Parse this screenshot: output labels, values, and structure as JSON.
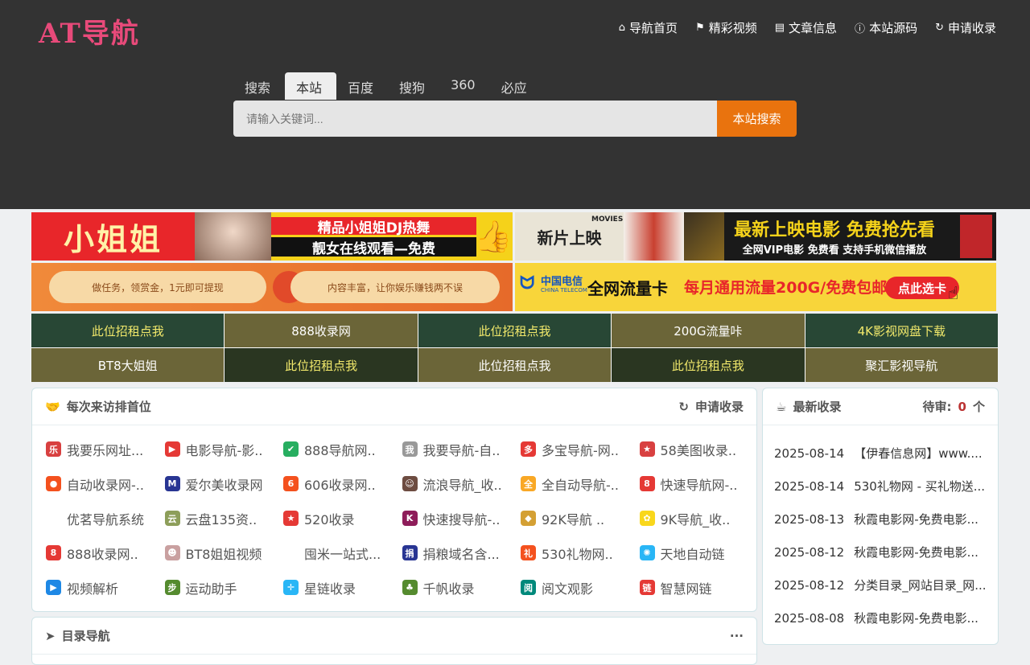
{
  "logo": "AT导航",
  "nav": [
    {
      "icon": "home-icon",
      "label": "导航首页"
    },
    {
      "icon": "flag-icon",
      "label": "精彩视频"
    },
    {
      "icon": "book-icon",
      "label": "文章信息"
    },
    {
      "icon": "info-icon",
      "label": "本站源码"
    },
    {
      "icon": "refresh-icon",
      "label": "申请收录"
    }
  ],
  "search": {
    "tabs": [
      "搜索",
      "本站",
      "百度",
      "搜狗",
      "360",
      "必应"
    ],
    "active_tab": "本站",
    "placeholder": "请输入关键词...",
    "button": "本站搜索"
  },
  "banners": [
    {
      "left_text": "小姐姐",
      "right_line1": "精品小姐姐DJ热舞",
      "right_line2": "靓女在线观看—免费"
    },
    {
      "left_text": "新片上映",
      "tag": "MOVIES",
      "line1": "最新上映电影 免费抢先看",
      "line2": "全网VIP电影 免费看 支持手机微信播放"
    },
    {
      "pill1": "做任务，领赏金，1元即可提现",
      "pill2": "内容丰富，让你娱乐赚钱两不误"
    },
    {
      "brand": "中国电信",
      "brand_en": "CHINA TELECOM",
      "line1": "全网流量卡",
      "line2": "每月通用流量200G/免费包邮",
      "cta": "点此选卡"
    }
  ],
  "ad_grid": [
    {
      "label": "此位招租点我",
      "bg": "#284735",
      "color": "#f2e96b"
    },
    {
      "label": "888收录网",
      "bg": "#6b6538",
      "color": "#ffffff"
    },
    {
      "label": "此位招租点我",
      "bg": "#284735",
      "color": "#f2e96b"
    },
    {
      "label": "200G流量咔",
      "bg": "#6b6538",
      "color": "#ffffff"
    },
    {
      "label": "4K影视网盘下载",
      "bg": "#284735",
      "color": "#f2e96b"
    },
    {
      "label": "BT8大姐姐",
      "bg": "#6b6538",
      "color": "#ffffff"
    },
    {
      "label": "此位招租点我",
      "bg": "#2a3621",
      "color": "#f2e96b"
    },
    {
      "label": "此位招租点我",
      "bg": "#6b6538",
      "color": "#ffffff"
    },
    {
      "label": "此位招租点我",
      "bg": "#2a3621",
      "color": "#f2e96b"
    },
    {
      "label": "聚汇影视导航",
      "bg": "#6b6538",
      "color": "#ffffff"
    }
  ],
  "first_visit": {
    "title": "每次来访排首位",
    "action": "申请收录",
    "links": [
      {
        "label": "我要乐网址...",
        "color": "#d84040",
        "glyph": "乐"
      },
      {
        "label": "电影导航-影..",
        "color": "#e53935",
        "glyph": "▶"
      },
      {
        "label": "888导航网..",
        "color": "#27ae60",
        "glyph": "✔"
      },
      {
        "label": "我要导航-自..",
        "color": "#999999",
        "glyph": "我"
      },
      {
        "label": "多宝导航-网..",
        "color": "#e53935",
        "glyph": "多"
      },
      {
        "label": "58美图收录..",
        "color": "#d84040",
        "glyph": "★"
      },
      {
        "label": "自动收录网-..",
        "color": "#f4511e",
        "glyph": "●"
      },
      {
        "label": "爱尔美收录网",
        "color": "#283593",
        "glyph": "M"
      },
      {
        "label": "606收录网..",
        "color": "#f4511e",
        "glyph": "6"
      },
      {
        "label": "流浪导航_收..",
        "color": "#6d4c41",
        "glyph": "☺"
      },
      {
        "label": "全自动导航-..",
        "color": "#f9a825",
        "glyph": "全"
      },
      {
        "label": "快速导航网-..",
        "color": "#e53935",
        "glyph": "8"
      },
      {
        "label": "优茗导航系统",
        "color": "",
        "glyph": ""
      },
      {
        "label": "云盘135资..",
        "color": "#8d9e5a",
        "glyph": "云"
      },
      {
        "label": "520收录",
        "color": "#e53935",
        "glyph": "★"
      },
      {
        "label": "快速搜导航-..",
        "color": "#8e1d5a",
        "glyph": "K"
      },
      {
        "label": "92K导航 ..",
        "color": "#d4a034",
        "glyph": "◆"
      },
      {
        "label": "9K导航_收..",
        "color": "#f9d71c",
        "glyph": "✿"
      },
      {
        "label": "888收录网..",
        "color": "#e53935",
        "glyph": "8"
      },
      {
        "label": "BT8姐姐视频",
        "color": "#c9a0a0",
        "glyph": "☻"
      },
      {
        "label": "囤米一站式...",
        "color": "",
        "glyph": ""
      },
      {
        "label": "捐粮域名含...",
        "color": "#283593",
        "glyph": "捐"
      },
      {
        "label": "530礼物网..",
        "color": "#f4511e",
        "glyph": "礼"
      },
      {
        "label": "天地自动链",
        "color": "#29b6f6",
        "glyph": "✺"
      },
      {
        "label": "视频解析",
        "color": "#1e88e5",
        "glyph": "▶"
      },
      {
        "label": "运动助手",
        "color": "#558b2f",
        "glyph": "步"
      },
      {
        "label": "星链收录",
        "color": "#29b6f6",
        "glyph": "✛"
      },
      {
        "label": "千帆收录",
        "color": "#558b2f",
        "glyph": "♣"
      },
      {
        "label": "阅文观影",
        "color": "#00897b",
        "glyph": "阅"
      },
      {
        "label": "智慧网链",
        "color": "#e53935",
        "glyph": "链"
      }
    ]
  },
  "latest": {
    "title": "最新收录",
    "pending_label": "待审:",
    "pending_count": "0",
    "pending_unit": "个",
    "items": [
      {
        "date": "2025-08-14",
        "title": "【伊春信息网】www...."
      },
      {
        "date": "2025-08-14",
        "title": "530礼物网 - 买礼物送..."
      },
      {
        "date": "2025-08-13",
        "title": "秋霞电影网-免费电影..."
      },
      {
        "date": "2025-08-12",
        "title": "秋霞电影网-免费电影..."
      },
      {
        "date": "2025-08-12",
        "title": "分类目录_网站目录_网..."
      },
      {
        "date": "2025-08-08",
        "title": "秋霞电影网-免费电影..."
      }
    ]
  },
  "directory": {
    "title": "目录导航",
    "more": "···"
  }
}
